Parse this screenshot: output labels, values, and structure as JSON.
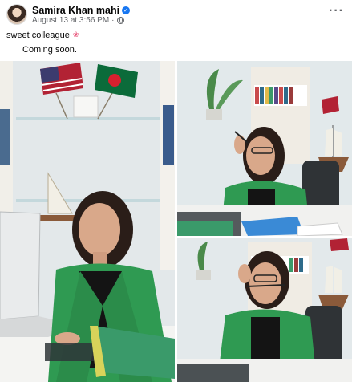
{
  "post": {
    "author": "Samira Khan mahi",
    "date": "August 13 at 3:56 PM",
    "separator": "·",
    "more_label": "···",
    "verified_mark": "✓",
    "caption_line1": "sweet colleague",
    "caption_emoji": "❀",
    "caption_line2": "Coming soon."
  },
  "icons": {
    "avatar": "profile-avatar",
    "verified": "verified-badge-icon",
    "audience": "globe-icon",
    "more": "more-options-icon"
  },
  "photos": [
    {
      "description_key": "photo-woman-laptop"
    },
    {
      "description_key": "photo-woman-desk-pen"
    },
    {
      "description_key": "photo-woman-glasses-playful"
    }
  ],
  "colors": {
    "accent": "#1877f2",
    "blazer": "#2f9a52",
    "meta": "#65676b"
  }
}
